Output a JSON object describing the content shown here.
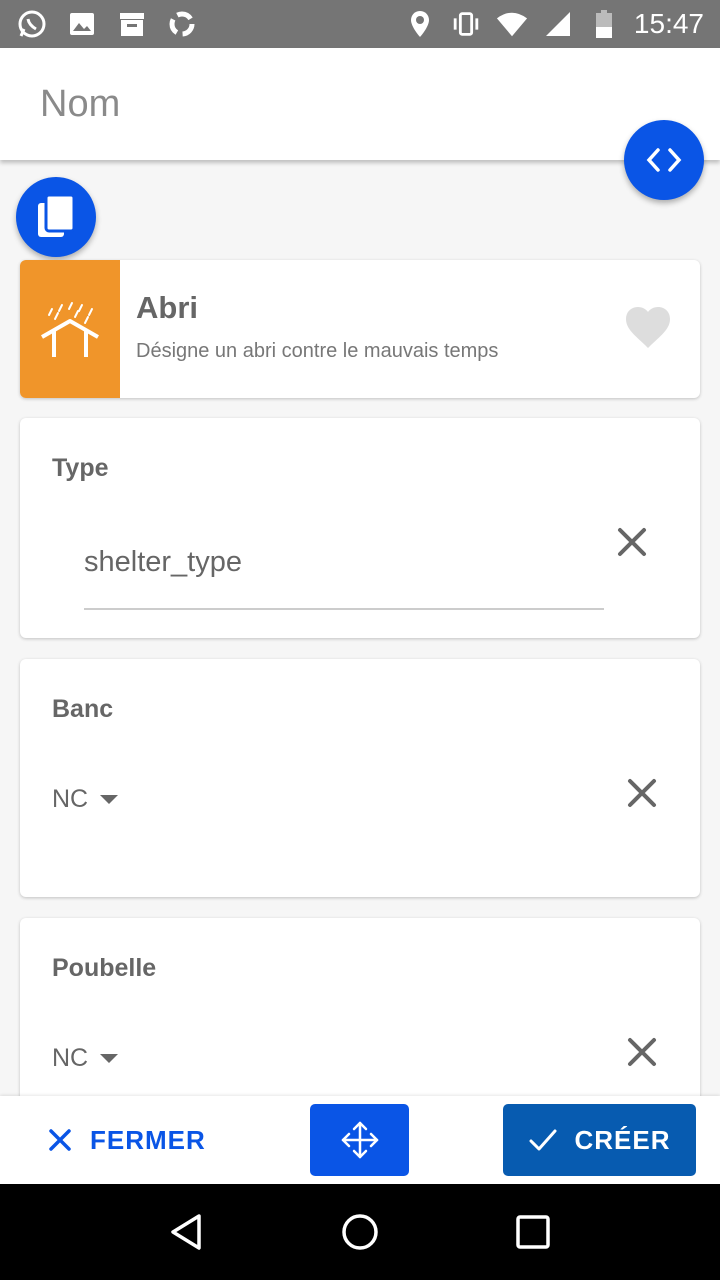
{
  "status_bar": {
    "time": "15:47",
    "left_icons": [
      "whatsapp-icon",
      "image-icon",
      "store-icon",
      "app-icon"
    ],
    "right_icons": [
      "location-icon",
      "vibrate-icon",
      "wifi-icon",
      "signal-icon",
      "battery-icon"
    ]
  },
  "header": {
    "name_placeholder": "Nom"
  },
  "preset": {
    "title": "Abri",
    "description": "Désigne un abri contre le mauvais temps",
    "icon": "shelter-icon",
    "favorite_icon": "heart-icon",
    "icon_bg": "#f0952a"
  },
  "fields": {
    "type": {
      "label": "Type",
      "value": "shelter_type"
    },
    "banc": {
      "label": "Banc",
      "value": "NC"
    },
    "poubelle": {
      "label": "Poubelle",
      "value": "NC"
    }
  },
  "actions": {
    "close_label": "FERMER",
    "create_label": "CRÉER"
  },
  "colors": {
    "accent": "#0a55e6",
    "create": "#075bb0",
    "status_bar": "#757575"
  }
}
